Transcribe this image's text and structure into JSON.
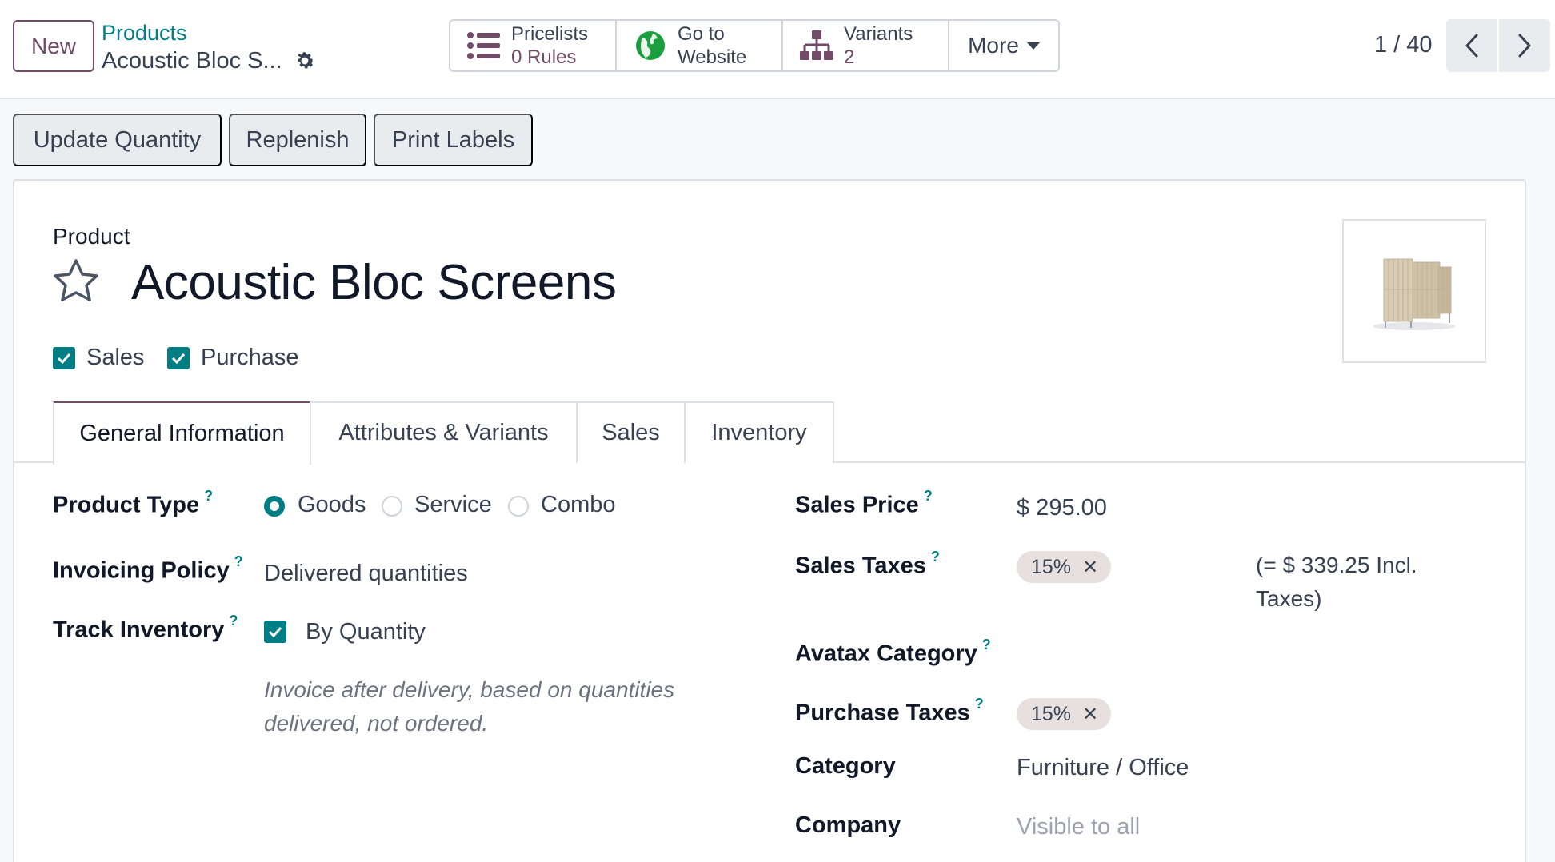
{
  "control_panel": {
    "new_label": "New",
    "breadcrumb_parent": "Products",
    "breadcrumb_current": "Acoustic Bloc S...",
    "smart_buttons": {
      "pricelists": {
        "title": "Pricelists",
        "value": "0 Rules",
        "icon": "list-icon"
      },
      "website": {
        "title": "Go to",
        "value": "Website",
        "icon": "globe-icon"
      },
      "variants": {
        "title": "Variants",
        "value": "2",
        "icon": "sitemap-icon"
      },
      "more_label": "More"
    },
    "pager": {
      "value": "1 / 40"
    }
  },
  "actions": {
    "update_quantity": "Update Quantity",
    "replenish": "Replenish",
    "print_labels": "Print Labels"
  },
  "product": {
    "section_label": "Product",
    "name": "Acoustic Bloc Screens",
    "can_be_sold_label": "Sales",
    "can_be_purchased_label": "Purchase",
    "can_be_sold": true,
    "can_be_purchased": true
  },
  "tabs": [
    {
      "label": "General Information",
      "active": true
    },
    {
      "label": "Attributes & Variants",
      "active": false
    },
    {
      "label": "Sales",
      "active": false
    },
    {
      "label": "Inventory",
      "active": false
    }
  ],
  "left_fields": {
    "product_type": {
      "label": "Product Type",
      "help": "?",
      "options": [
        "Goods",
        "Service",
        "Combo"
      ],
      "selected": "Goods"
    },
    "invoicing_policy": {
      "label": "Invoicing Policy",
      "help": "?",
      "value": "Delivered quantities"
    },
    "track_inventory": {
      "label": "Track Inventory",
      "help": "?",
      "value": "By Quantity",
      "checked": true
    },
    "hint": "Invoice after delivery, based on quantities delivered, not ordered."
  },
  "right_fields": {
    "sales_price": {
      "label": "Sales Price",
      "help": "?",
      "value": "$ 295.00"
    },
    "sales_taxes": {
      "label": "Sales Taxes",
      "help": "?",
      "tag": "15%",
      "incl_text": "(= $ 339.25 Incl. Taxes)"
    },
    "avatax_category": {
      "label": "Avatax Category",
      "help": "?",
      "value": ""
    },
    "purchase_taxes": {
      "label": "Purchase Taxes",
      "help": "?",
      "tag": "15%"
    },
    "category": {
      "label": "Category",
      "value": "Furniture / Office"
    },
    "company": {
      "label": "Company",
      "placeholder": "Visible to all"
    }
  },
  "colors": {
    "brand": "#714b67",
    "accent": "#017e84",
    "tag_bg": "#e7e0df"
  }
}
